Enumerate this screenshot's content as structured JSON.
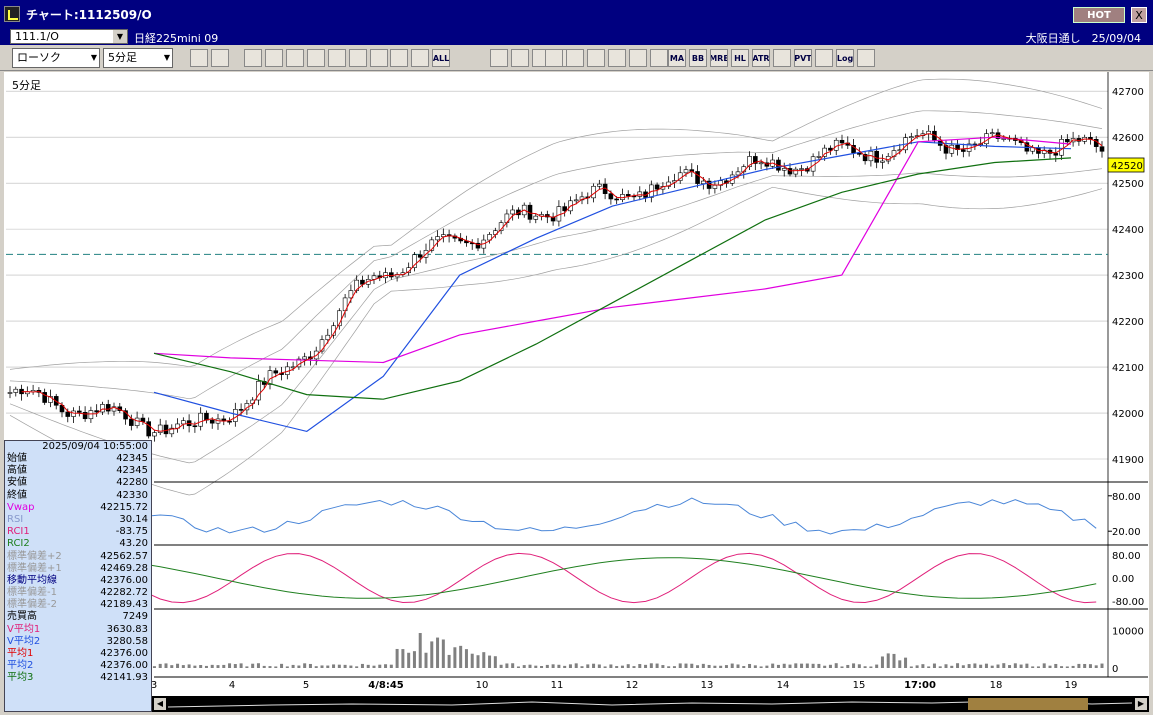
{
  "window": {
    "title": "チャート:1112509/O",
    "hot_label": "HOT",
    "close_label": "X"
  },
  "symbol_bar": {
    "code": "111.1/O",
    "name": "日経225mini 09",
    "market": "大阪日通し　25/09/04"
  },
  "toolbar": {
    "chart_type": "ローソク",
    "interval": "5分足",
    "buttons": [
      "",
      "",
      "",
      "",
      "",
      "",
      "",
      "",
      "",
      "",
      "",
      "ALL",
      "",
      "",
      "",
      "",
      "",
      "",
      "",
      "",
      "",
      "",
      "MA",
      "BB",
      "MRE",
      "HL",
      "ATR",
      "",
      "PVT",
      "",
      "Log",
      ""
    ]
  },
  "chart": {
    "panel_label": "5分足",
    "current_price": "42520",
    "price_ticks": [
      "42700",
      "42600",
      "42500",
      "42400",
      "42300",
      "42200",
      "42100",
      "42000",
      "41900"
    ],
    "rsi_ticks": [
      "80.00",
      "20.00"
    ],
    "rci_ticks": [
      "80.00",
      "0.00",
      "-80.00"
    ],
    "volume_ticks": [
      "10000",
      "0"
    ],
    "time_labels": [
      "3",
      "4",
      "5",
      "4/8:45",
      "10",
      "11",
      "12",
      "13",
      "14",
      "15",
      "17:00",
      "18",
      "19"
    ],
    "colors": {
      "candle_up": "#ffffff",
      "candle_down": "#000000",
      "vwap": "#e000e0",
      "ma_red": "#e00000",
      "ma_blue": "#2050e0",
      "ma_green": "#107010",
      "bollinger": "#a0a0a0",
      "rsi": "#4a86d8",
      "rci1": "#e0207a",
      "rci2": "#208020",
      "volume": "#808080",
      "ref_line": "#208080"
    }
  },
  "chart_data": {
    "type": "line",
    "title": "",
    "xlabel": "",
    "ylabel": "",
    "ylim": [
      41850,
      42720
    ],
    "x": [
      "3",
      "4",
      "5",
      "4/8:45",
      "10",
      "11",
      "12",
      "13",
      "14",
      "15",
      "17:00",
      "18",
      "19"
    ],
    "series": [
      {
        "name": "移動平均線",
        "values": [
          42045,
          42000,
          41960,
          42080,
          42300,
          42380,
          42450,
          42490,
          42530,
          42560,
          42590,
          42580,
          42575
        ]
      },
      {
        "name": "Vwap",
        "values": [
          42130,
          42120,
          42115,
          42110,
          42170,
          42200,
          42230,
          42250,
          42270,
          42300,
          42590,
          42600,
          42585
        ]
      },
      {
        "name": "平均3",
        "values": [
          42130,
          42090,
          42040,
          42030,
          42070,
          42150,
          42240,
          42330,
          42420,
          42480,
          42520,
          42545,
          42555
        ]
      }
    ]
  },
  "info": {
    "datetime": "2025/09/04  10:55:00",
    "rows": [
      {
        "label": "始値",
        "value": "42345",
        "color": "#000000"
      },
      {
        "label": "高値",
        "value": "42345",
        "color": "#000000"
      },
      {
        "label": "安値",
        "value": "42280",
        "color": "#000000"
      },
      {
        "label": "終値",
        "value": "42330",
        "color": "#000000"
      },
      {
        "label": "Vwap",
        "value": "42215.72",
        "color": "#e000e0"
      },
      {
        "label": "RSI",
        "value": "30.14",
        "color": "#8899cc"
      },
      {
        "label": "RCI1",
        "value": "-83.75",
        "color": "#e0207a"
      },
      {
        "label": "RCI2",
        "value": "43.20",
        "color": "#208020"
      },
      {
        "label": "標準偏差+2",
        "value": "42562.57",
        "color": "#999999"
      },
      {
        "label": "標準偏差+1",
        "value": "42469.28",
        "color": "#999999"
      },
      {
        "label": "移動平均線",
        "value": "42376.00",
        "color": "#000080"
      },
      {
        "label": "標準偏差-1",
        "value": "42282.72",
        "color": "#999999"
      },
      {
        "label": "標準偏差-2",
        "value": "42189.43",
        "color": "#999999"
      },
      {
        "label": "売買高",
        "value": "7249",
        "color": "#000000"
      },
      {
        "label": "V平均1",
        "value": "3630.83",
        "color": "#e0207a"
      },
      {
        "label": "V平均2",
        "value": "3280.58",
        "color": "#2050e0"
      },
      {
        "label": "平均1",
        "value": "42376.00",
        "color": "#e00000"
      },
      {
        "label": "平均2",
        "value": "42376.00",
        "color": "#2050e0"
      },
      {
        "label": "平均3",
        "value": "42141.93",
        "color": "#107010"
      }
    ]
  }
}
